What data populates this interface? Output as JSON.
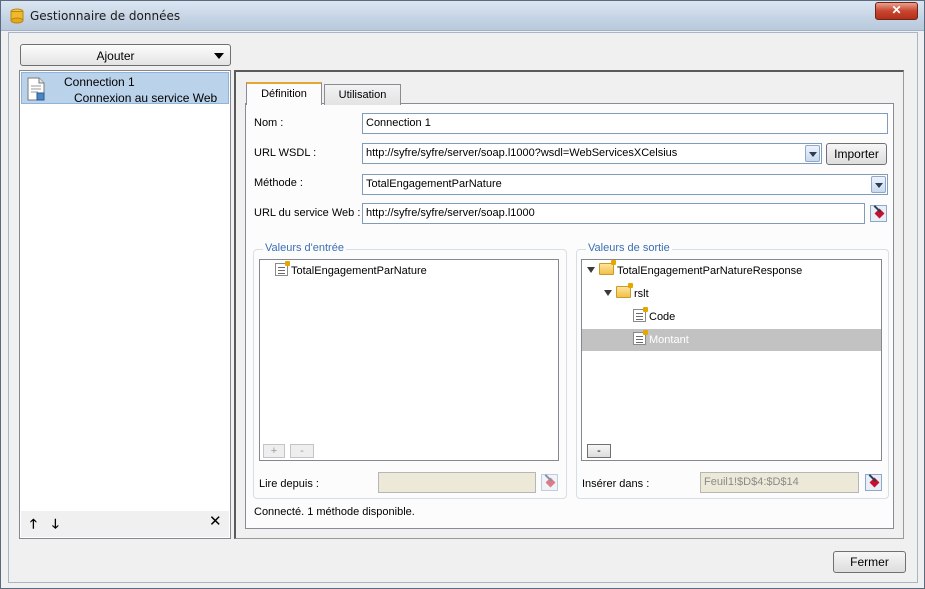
{
  "window": {
    "title": "Gestionnaire de données",
    "close_glyph": "✕"
  },
  "add": {
    "label": "Ajouter"
  },
  "connections": [
    {
      "name": "Connection 1",
      "type": "Connexion au service Web"
    }
  ],
  "list_controls": {
    "up": "🡑",
    "down": "🡓",
    "delete": "✕"
  },
  "tabs": [
    {
      "label": "Définition",
      "active": true
    },
    {
      "label": "Utilisation",
      "active": false
    }
  ],
  "form": {
    "name_label": "Nom :",
    "name_value": "Connection 1",
    "wsdl_label": "URL WSDL :",
    "wsdl_value": "http://syfre/syfre/server/soap.l1000?wsdl=WebServicesXCelsius",
    "import_label": "Importer",
    "method_label": "Méthode :",
    "method_value": "TotalEngagementParNature",
    "service_url_label": "URL du service Web :",
    "service_url_value": "http://syfre/syfre/server/soap.l1000"
  },
  "inputs": {
    "title": "Valeurs d'entrée",
    "tree": [
      {
        "label": "TotalEngagementParNature"
      }
    ],
    "add_btn": "+",
    "remove_btn": "-",
    "read_from_label": "Lire depuis :",
    "read_from_value": ""
  },
  "outputs": {
    "title": "Valeurs de sortie",
    "root": "TotalEngagementParNatureResponse",
    "child": "rslt",
    "leaves": [
      {
        "label": "Code",
        "selected": false
      },
      {
        "label": "Montant",
        "selected": true
      }
    ],
    "remove_btn": "-",
    "insert_label": "Insérer dans :",
    "insert_value": "Feuil1!$D$4:$D$14"
  },
  "status": "Connecté.  1 méthode disponible.",
  "footer": {
    "close_label": "Fermer"
  },
  "colors": {
    "selection": "#bad2ea",
    "group_title": "#3c6fb4",
    "tab_active_accent": "#e3a735"
  }
}
